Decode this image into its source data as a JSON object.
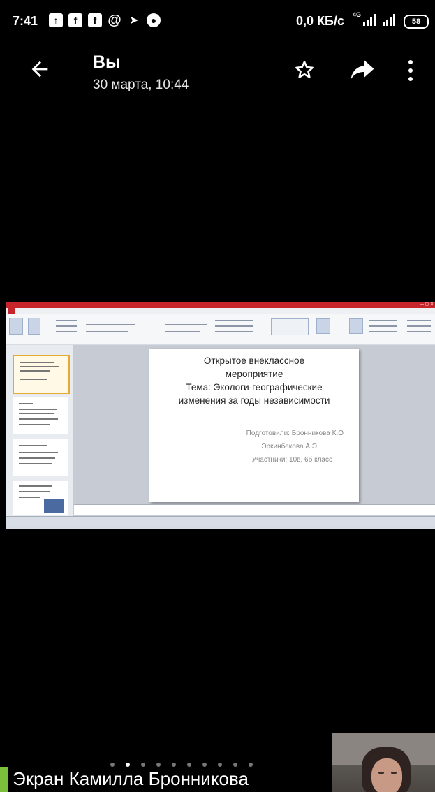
{
  "status_bar": {
    "time": "7:41",
    "notification_icons": [
      "upload-icon",
      "facebook-icon",
      "facebook-icon",
      "at-icon",
      "send-icon",
      "soccer-ball-icon"
    ],
    "speed": "0,0 КБ/с",
    "network": "4G",
    "battery": "58"
  },
  "header": {
    "title": "Вы",
    "subtitle": "30 марта, 10:44",
    "icons": [
      "back-arrow-icon",
      "star-icon",
      "share-icon",
      "more-vert-icon"
    ]
  },
  "shared_screen": {
    "slide": {
      "title_lines": [
        "Открытое внеклассное",
        "мероприятие",
        "Тема: Экологи-географические",
        "изменения за годы независимости"
      ],
      "meta_lines": [
        "Подготовили: Бронникова К.О",
        "Эркинбекова А.Э",
        "Участники: 10в, 6б класс"
      ]
    }
  },
  "pager": {
    "count": 10,
    "active": 1
  },
  "caption": "Экран Камилла Бронникова",
  "colors": {
    "background": "#000000",
    "ppt_accent": "#c8242c"
  }
}
